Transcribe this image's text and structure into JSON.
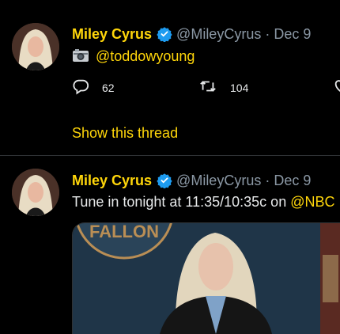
{
  "tweets": [
    {
      "name": "Miley Cyrus",
      "handle": "@MileyCyrus",
      "separator": "·",
      "date": "Dec 9",
      "text_mention": "@toddowyoung",
      "actions": {
        "reply_count": "62",
        "retweet_count": "104"
      },
      "show_thread": "Show this thread"
    },
    {
      "name": "Miley Cyrus",
      "handle": "@MileyCyrus",
      "separator": "·",
      "date": "Dec 9",
      "text": "Tune in tonight at 11:35/10:35c on ",
      "text_mention": "@NBC",
      "media_sign": "FALLON"
    }
  ],
  "colors": {
    "accent": "#ffd60a",
    "secondary": "#8b98a5",
    "verified": "#1d9bf0",
    "divider": "#2f3336"
  },
  "icons": [
    "verified-icon",
    "camera-icon",
    "reply-icon",
    "retweet-icon",
    "like-icon"
  ]
}
